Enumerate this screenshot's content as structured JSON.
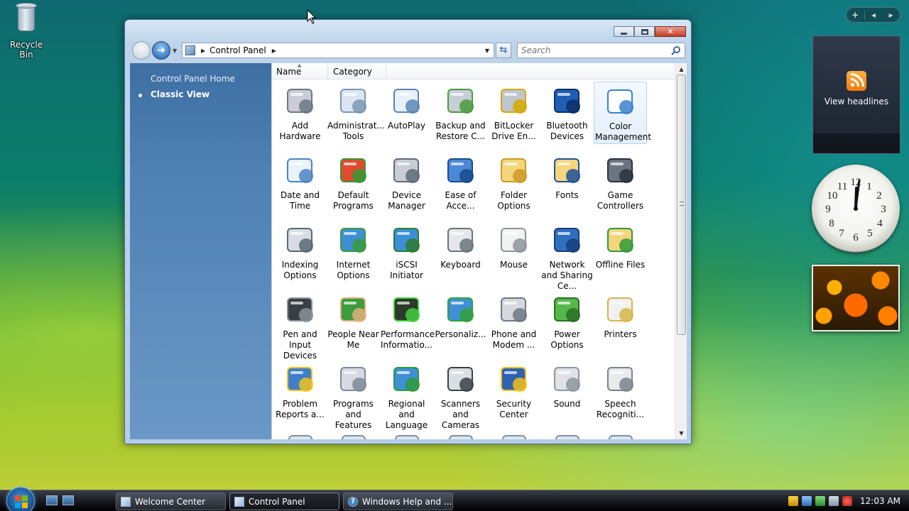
{
  "desktop": {
    "recycle_bin_label": "Recycle Bin"
  },
  "gadgets": {
    "feed_label": "View headlines",
    "clock_hour_numbers": [
      "12",
      "1",
      "2",
      "3",
      "4",
      "5",
      "6",
      "7",
      "8",
      "9",
      "10",
      "11"
    ]
  },
  "window": {
    "title": "Control Panel",
    "address_crumb": "Control Panel",
    "search_placeholder": "Search",
    "left_pane": {
      "home_link": "Control Panel Home",
      "classic_view": "Classic View"
    },
    "columns": {
      "name": "Name",
      "category": "Category"
    },
    "items": [
      {
        "label": "Add Hardware",
        "icon": "add-hardware-icon"
      },
      {
        "label": "Administrat... Tools",
        "icon": "admin-tools-icon"
      },
      {
        "label": "AutoPlay",
        "icon": "autoplay-icon"
      },
      {
        "label": "Backup and Restore C...",
        "icon": "backup-icon"
      },
      {
        "label": "BitLocker Drive En...",
        "icon": "bitlocker-icon"
      },
      {
        "label": "Bluetooth Devices",
        "icon": "bluetooth-icon"
      },
      {
        "label": "Color Management",
        "icon": "color-management-icon"
      },
      {
        "label": "Date and Time",
        "icon": "date-time-icon"
      },
      {
        "label": "Default Programs",
        "icon": "default-programs-icon"
      },
      {
        "label": "Device Manager",
        "icon": "device-manager-icon"
      },
      {
        "label": "Ease of Acce...",
        "icon": "ease-of-access-icon"
      },
      {
        "label": "Folder Options",
        "icon": "folder-options-icon"
      },
      {
        "label": "Fonts",
        "icon": "fonts-icon"
      },
      {
        "label": "Game Controllers",
        "icon": "game-controller-icon"
      },
      {
        "label": "Indexing Options",
        "icon": "indexing-icon"
      },
      {
        "label": "Internet Options",
        "icon": "internet-options-icon"
      },
      {
        "label": "iSCSI Initiator",
        "icon": "iscsi-icon"
      },
      {
        "label": "Keyboard",
        "icon": "keyboard-icon"
      },
      {
        "label": "Mouse",
        "icon": "mouse-icon"
      },
      {
        "label": "Network and Sharing Ce...",
        "icon": "network-icon"
      },
      {
        "label": "Offline Files",
        "icon": "offline-files-icon"
      },
      {
        "label": "Pen and Input Devices",
        "icon": "pen-icon"
      },
      {
        "label": "People Near Me",
        "icon": "people-near-me-icon"
      },
      {
        "label": "Performance Informatio...",
        "icon": "performance-icon"
      },
      {
        "label": "Personaliz...",
        "icon": "personalization-icon"
      },
      {
        "label": "Phone and Modem ...",
        "icon": "phone-modem-icon"
      },
      {
        "label": "Power Options",
        "icon": "power-icon"
      },
      {
        "label": "Printers",
        "icon": "printer-icon"
      },
      {
        "label": "Problem Reports a...",
        "icon": "problem-reports-icon"
      },
      {
        "label": "Programs and Features",
        "icon": "programs-features-icon"
      },
      {
        "label": "Regional and Language ...",
        "icon": "regional-icon"
      },
      {
        "label": "Scanners and Cameras",
        "icon": "scanner-icon"
      },
      {
        "label": "Security Center",
        "icon": "security-center-icon"
      },
      {
        "label": "Sound",
        "icon": "sound-icon"
      },
      {
        "label": "Speech Recogniti...",
        "icon": "speech-icon"
      }
    ],
    "selected_item": "Color Management"
  },
  "taskbar": {
    "buttons": [
      {
        "label": "Welcome Center"
      },
      {
        "label": "Control Panel"
      },
      {
        "label": "Windows Help and ..."
      }
    ],
    "clock": "12:03 AM"
  }
}
